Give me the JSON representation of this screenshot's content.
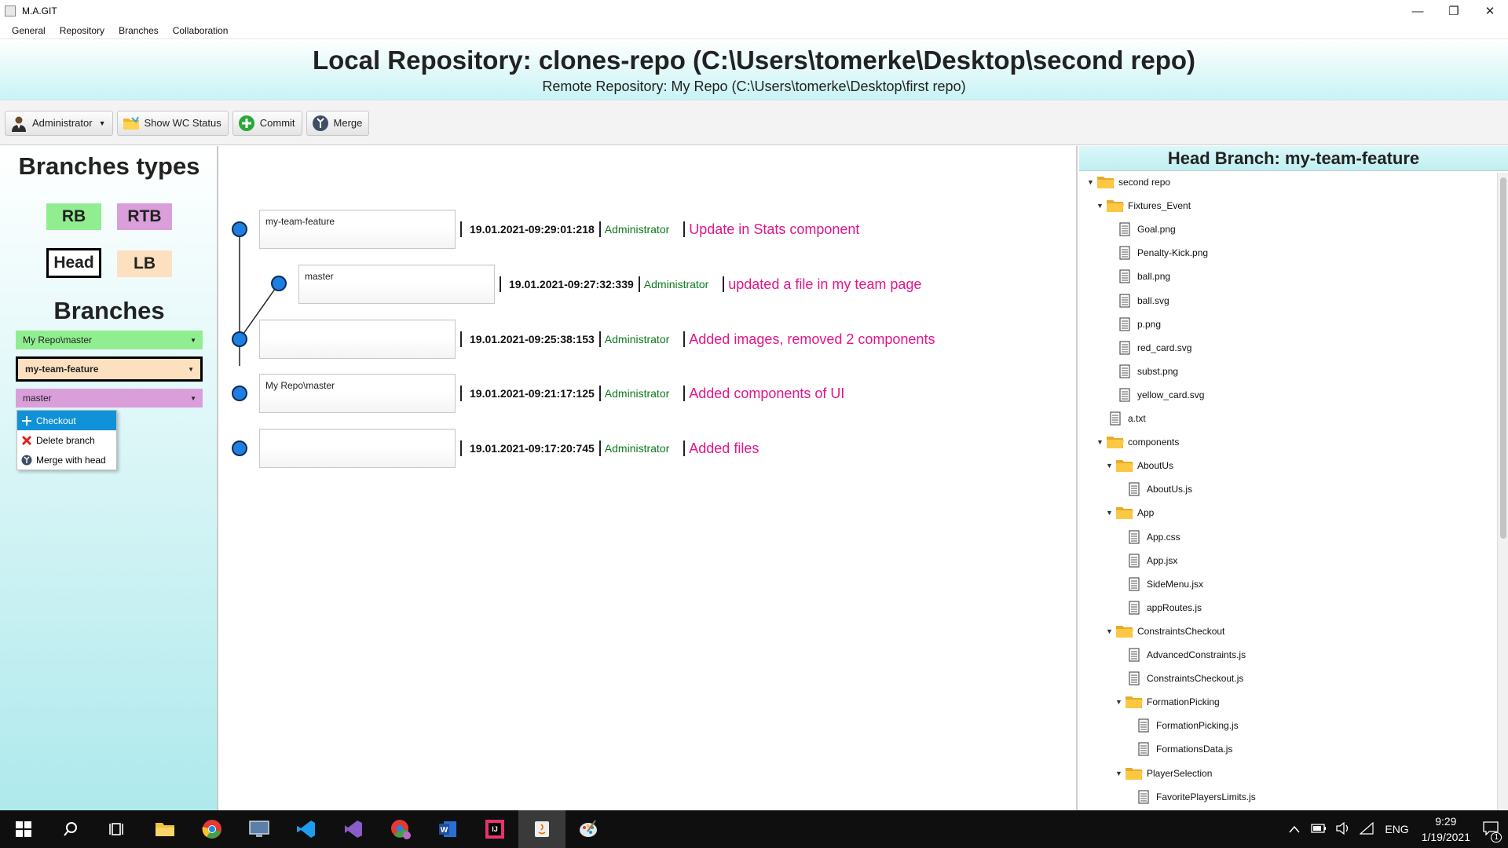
{
  "window": {
    "title": "M.A.GIT",
    "minimize_glyph": "—",
    "restore_glyph": "❐",
    "close_glyph": "✕"
  },
  "menu": [
    "General",
    "Repository",
    "Branches",
    "Collaboration"
  ],
  "header": {
    "local": "Local Repository: clones-repo (C:\\Users\\tomerke\\Desktop\\second repo)",
    "remote": "Remote Repository: My Repo (C:\\Users\\tomerke\\Desktop\\first repo)"
  },
  "toolbar": {
    "user_label": "Administrator",
    "wc_label": "Show WC Status",
    "commit_label": "Commit",
    "merge_label": "Merge"
  },
  "left": {
    "types_title": "Branches types",
    "types": {
      "rb": "RB",
      "rtb": "RTB",
      "head": "Head",
      "lb": "LB"
    },
    "branches_title": "Branches",
    "branches": [
      "My Repo\\master",
      "my-team-feature",
      "master"
    ],
    "context_menu": [
      "Checkout",
      "Delete branch",
      "Merge with head"
    ]
  },
  "colors": {
    "rb": "#90ee90",
    "rtb": "#da9fdb",
    "lb": "#fde0c0",
    "head_border": "#000000",
    "commit_node": "#1e7fe0",
    "author": "#0b7a1c",
    "message": "#e2168a",
    "selected": "#0f92d8"
  },
  "commits": [
    {
      "tag": "my-team-feature",
      "date": "19.01.2021-09:29:01:218",
      "author": "Administrator",
      "message": "Update in Stats component"
    },
    {
      "tag": "master",
      "date": "19.01.2021-09:27:32:339",
      "author": "Administrator",
      "message": "updated a file in my team page"
    },
    {
      "tag": "",
      "date": "19.01.2021-09:25:38:153",
      "author": "Administrator",
      "message": "Added images, removed 2 components"
    },
    {
      "tag": "My Repo\\master",
      "date": "19.01.2021-09:21:17:125",
      "author": "Administrator",
      "message": "Added components of UI"
    },
    {
      "tag": "",
      "date": "19.01.2021-09:17:20:745",
      "author": "Administrator",
      "message": "Added files"
    }
  ],
  "right": {
    "title": "Head Branch: my-team-feature",
    "tree": [
      {
        "name": "second repo",
        "type": "folder",
        "depth": 0
      },
      {
        "name": "Fixtures_Event",
        "type": "folder",
        "depth": 1
      },
      {
        "name": "Goal.png",
        "type": "file",
        "depth": 2
      },
      {
        "name": "Penalty-Kick.png",
        "type": "file",
        "depth": 2
      },
      {
        "name": "ball.png",
        "type": "file",
        "depth": 2
      },
      {
        "name": "ball.svg",
        "type": "file",
        "depth": 2
      },
      {
        "name": "p.png",
        "type": "file",
        "depth": 2
      },
      {
        "name": "red_card.svg",
        "type": "file",
        "depth": 2
      },
      {
        "name": "subst.png",
        "type": "file",
        "depth": 2
      },
      {
        "name": "yellow_card.svg",
        "type": "file",
        "depth": 2
      },
      {
        "name": "a.txt",
        "type": "file",
        "depth": 1
      },
      {
        "name": "components",
        "type": "folder",
        "depth": 1
      },
      {
        "name": "AboutUs",
        "type": "folder",
        "depth": 2
      },
      {
        "name": "AboutUs.js",
        "type": "file",
        "depth": 3
      },
      {
        "name": "App",
        "type": "folder",
        "depth": 2
      },
      {
        "name": "App.css",
        "type": "file",
        "depth": 3
      },
      {
        "name": "App.jsx",
        "type": "file",
        "depth": 3
      },
      {
        "name": "SideMenu.jsx",
        "type": "file",
        "depth": 3
      },
      {
        "name": "appRoutes.js",
        "type": "file",
        "depth": 3
      },
      {
        "name": "ConstraintsCheckout",
        "type": "folder",
        "depth": 2
      },
      {
        "name": "AdvancedConstraints.js",
        "type": "file",
        "depth": 3
      },
      {
        "name": "ConstraintsCheckout.js",
        "type": "file",
        "depth": 3
      },
      {
        "name": "FormationPicking",
        "type": "folder",
        "depth": 3
      },
      {
        "name": "FormationPicking.js",
        "type": "file",
        "depth": 4
      },
      {
        "name": "FormationsData.js",
        "type": "file",
        "depth": 4
      },
      {
        "name": "PlayerSelection",
        "type": "folder",
        "depth": 3
      },
      {
        "name": "FavoritePlayersLimits.js",
        "type": "file",
        "depth": 4
      }
    ]
  },
  "taskbar": {
    "icons": [
      "windows-start-icon",
      "search-icon",
      "task-view-icon",
      "file-explorer-icon",
      "chrome-icon",
      "remote-desktop-icon",
      "vscode-icon",
      "visual-studio-icon",
      "chrome-profile-icon",
      "word-icon",
      "intellij-icon",
      "java-app-icon",
      "paint-icon"
    ],
    "language": "ENG",
    "time": "9:29",
    "date": "1/19/2021",
    "notifications": "1"
  }
}
